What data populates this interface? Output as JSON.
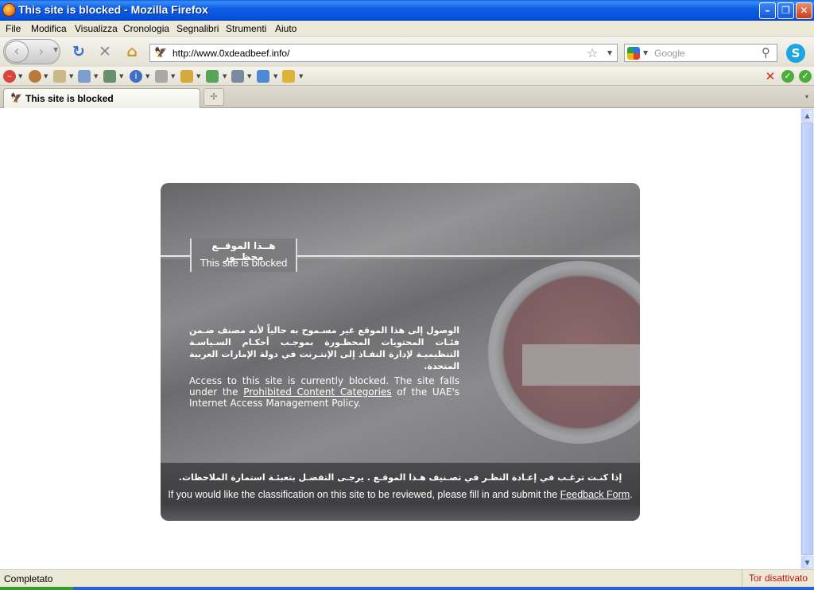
{
  "window": {
    "title": "This site is blocked - Mozilla Firefox",
    "minimize": "–",
    "maximize": "❐",
    "close": "✕"
  },
  "menu": {
    "items": [
      "File",
      "Modifica",
      "Visualizza",
      "Cronologia",
      "Segnalibri",
      "Strumenti",
      "Aiuto"
    ]
  },
  "nav": {
    "back_icon": "‹",
    "forward_icon": "›",
    "reload_icon": "↻",
    "stop_icon": "✕",
    "home_icon": "⌂",
    "url": "http://www.0xdeadbeef.info/",
    "bookmark_star_icon": "☆",
    "search_placeholder": "Google",
    "search_go_icon": "⚲",
    "skype_icon": "S"
  },
  "tabs": [
    {
      "label": "This site is blocked",
      "active": true
    }
  ],
  "tabbar": {
    "new_tab_icon": "✢",
    "list_icon": "▾"
  },
  "page": {
    "ar_title": "هــذا الموقــع محظــور",
    "en_title": "This site is blocked",
    "ar_body": "الوصول إلى هذا الموقع غير مسـموح به حالياً لأنه مصنف ضـمن فئـات المحتويات المحظـورة بموجـب أحكـام السـياسـة التنظيميـة لإدارة النفـاذ إلى الإنتـرنت في دولة الإمارات العربية المتحدة.",
    "en_body_before": "Access to this site is currently blocked.  The site falls under the ",
    "en_body_link": "Prohibited Content Categories",
    "en_body_after": " of the UAE's Internet Access Management Policy.",
    "ar_footer": "إذا كنـت ترغـب في إعـادة النظـر في تصـنيف هـذا الموقـع . يرجـى التفضـل بتعبئـة استمارة الملاحظات.",
    "en_footer_before": "If you would like the classification on this site to be reviewed, please fill in and submit the ",
    "en_footer_link": "Feedback Form",
    "en_footer_after": "."
  },
  "status": {
    "text": "Completato",
    "tor": "Tor disattivato"
  },
  "colors": {
    "title_bar": "#0d5fe3",
    "card_gray": "#7c7c7e",
    "tor_red": "#c8100a"
  }
}
